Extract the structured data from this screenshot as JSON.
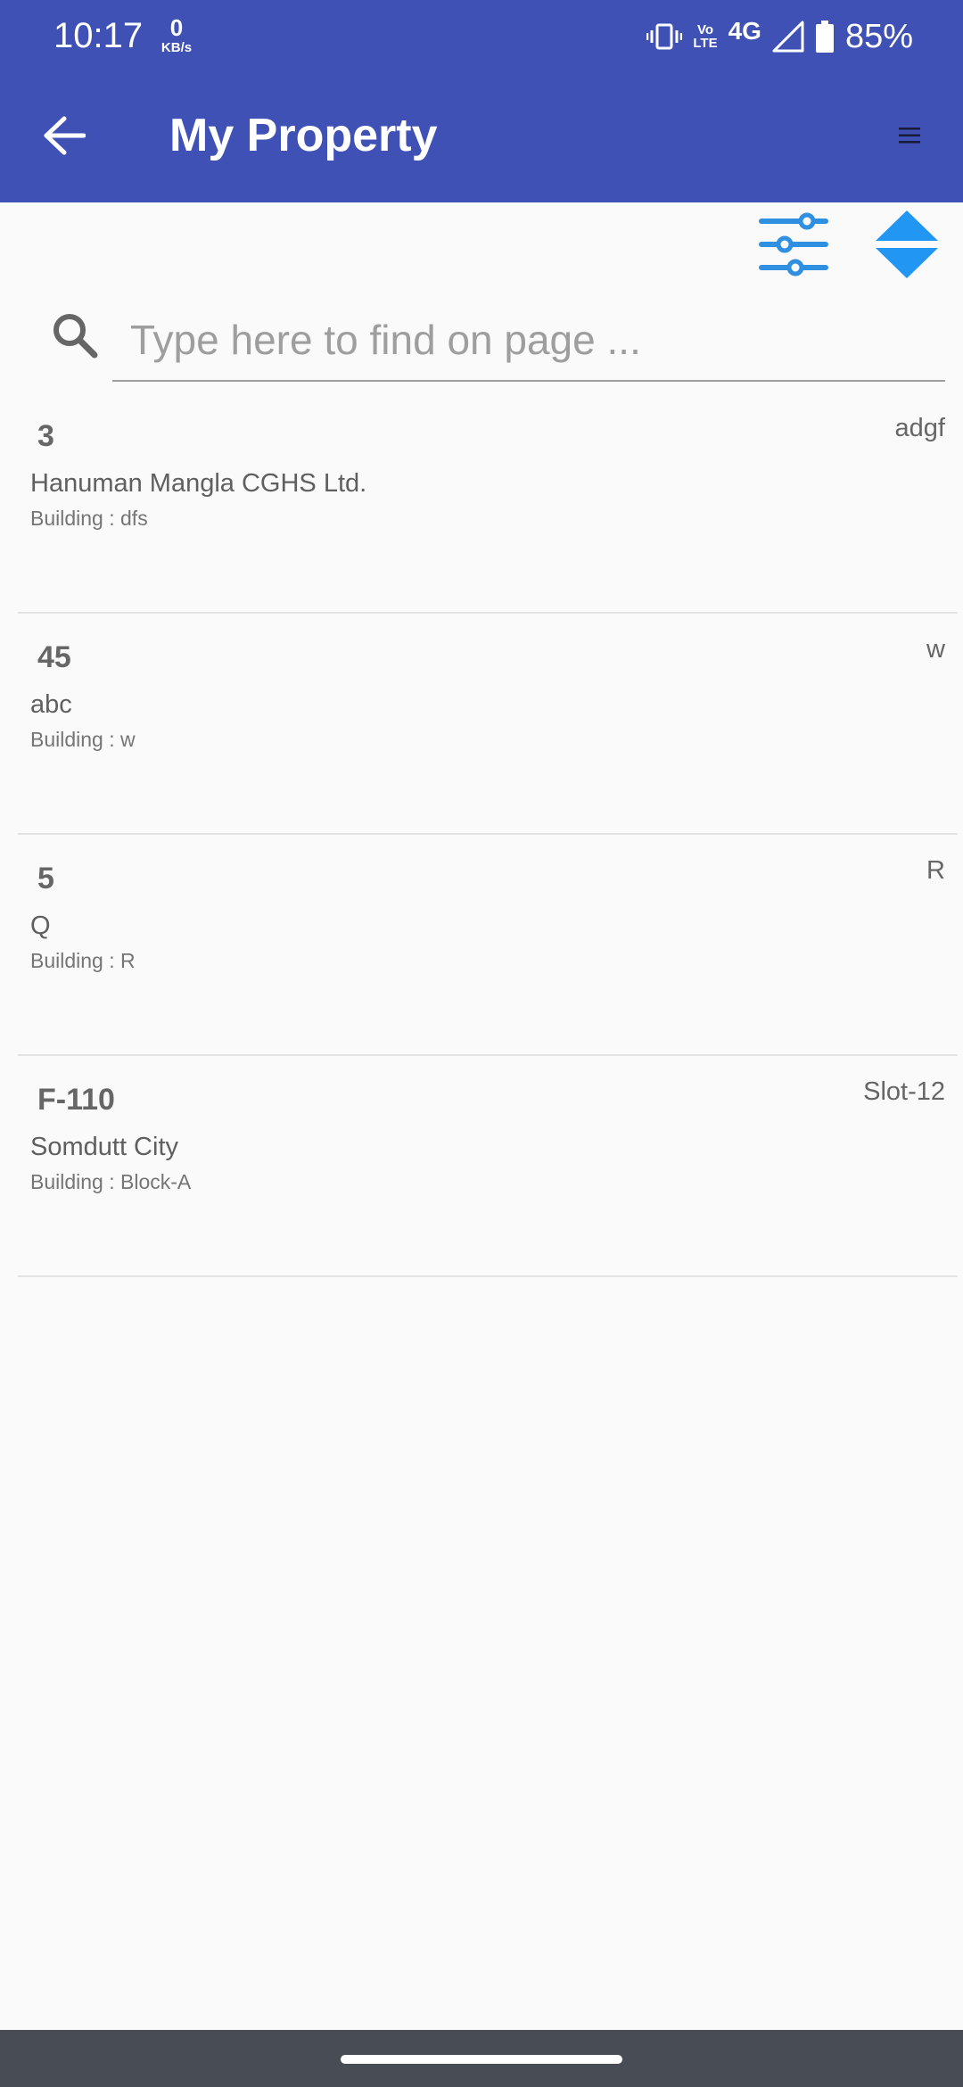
{
  "status_bar": {
    "time": "10:17",
    "net_speed_value": "0",
    "net_speed_unit": "KB/s",
    "volte_top": "Vo",
    "volte_bottom": "LTE",
    "network": "4G",
    "battery": "85%",
    "icons": [
      "vibrate-icon",
      "volte-icon",
      "signal-icon",
      "battery-icon"
    ]
  },
  "header": {
    "title": "My Property",
    "back_icon": "arrow-left-icon",
    "menu_icon": "hamburger-menu-icon",
    "background": "#3f51b5"
  },
  "toolbar": {
    "filter_icon": "filter-sliders-icon",
    "sort_icon": "sort-arrows-icon",
    "accent": "#2196f3"
  },
  "search": {
    "placeholder": "Type here to find on page ...",
    "value": ""
  },
  "properties": [
    {
      "number": "3",
      "slot": "adgf",
      "society": "Hanuman Mangla CGHS Ltd.",
      "building": "Building : dfs"
    },
    {
      "number": "45",
      "slot": "w",
      "society": "abc",
      "building": "Building : w"
    },
    {
      "number": "5",
      "slot": "R",
      "society": "Q",
      "building": "Building : R"
    },
    {
      "number": "F-110",
      "slot": "Slot-12",
      "society": "Somdutt City",
      "building": "Building : Block-A"
    }
  ]
}
